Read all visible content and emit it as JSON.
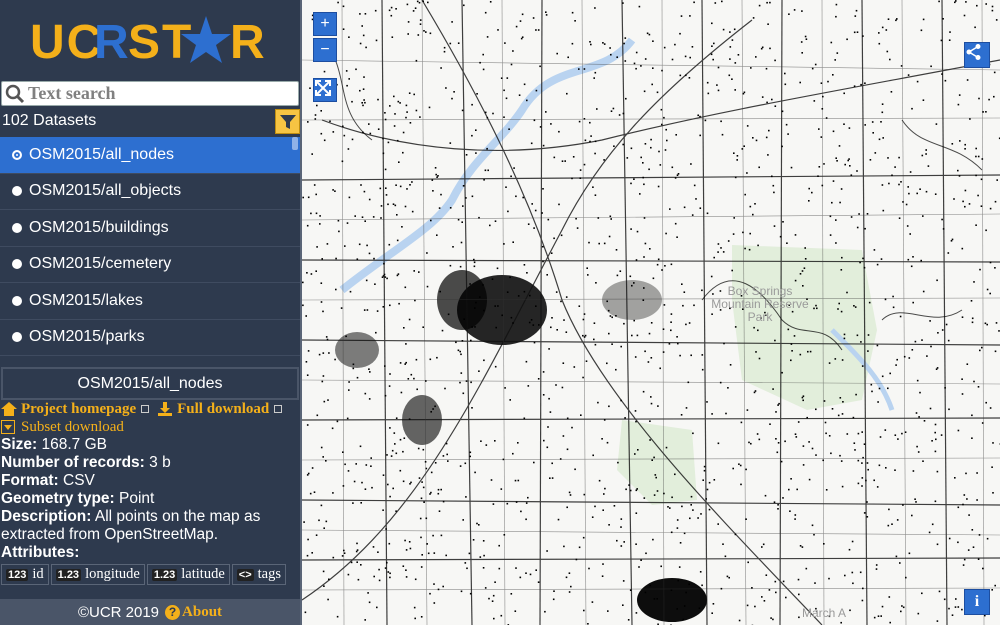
{
  "logo": {
    "text": "UCRSTAR"
  },
  "search": {
    "placeholder": "Text search",
    "icon": "search-icon"
  },
  "datasets": {
    "count_label": "102 Datasets",
    "items": [
      {
        "label": "OSM2015/all_nodes",
        "selected": true
      },
      {
        "label": "OSM2015/all_objects",
        "selected": false
      },
      {
        "label": "OSM2015/buildings",
        "selected": false
      },
      {
        "label": "OSM2015/cemetery",
        "selected": false
      },
      {
        "label": "OSM2015/lakes",
        "selected": false
      },
      {
        "label": "OSM2015/parks",
        "selected": false
      }
    ]
  },
  "details": {
    "title": "OSM2015/all_nodes",
    "project_homepage": "Project homepage",
    "full_download": "Full download",
    "subset_download": "Subset download",
    "size_label": "Size:",
    "size_value": "168.7 GB",
    "records_label": "Number of records:",
    "records_value": "3 b",
    "format_label": "Format:",
    "format_value": "CSV",
    "geometry_label": "Geometry type:",
    "geometry_value": "Point",
    "description_label": "Description:",
    "description_value": "All points on the map as extracted from OpenStreetMap.",
    "attributes_label": "Attributes:",
    "attributes": [
      {
        "badge": "123",
        "name": "id"
      },
      {
        "badge": "1.23",
        "name": "longitude"
      },
      {
        "badge": "1.23",
        "name": "latitude"
      },
      {
        "badge": "<>",
        "name": "tags"
      }
    ]
  },
  "footer": {
    "copyright": "©UCR 2019",
    "about": "About"
  },
  "map": {
    "zoom_in": "+",
    "zoom_out": "−",
    "info": "i",
    "labels": [
      "Box Springs Mountain Reserve Park",
      "March A"
    ]
  },
  "colors": {
    "sidebar": "#2e3a4e",
    "accent": "#f4b01a",
    "selected": "#2d6fd0",
    "map_button": "#2d6fd0"
  }
}
